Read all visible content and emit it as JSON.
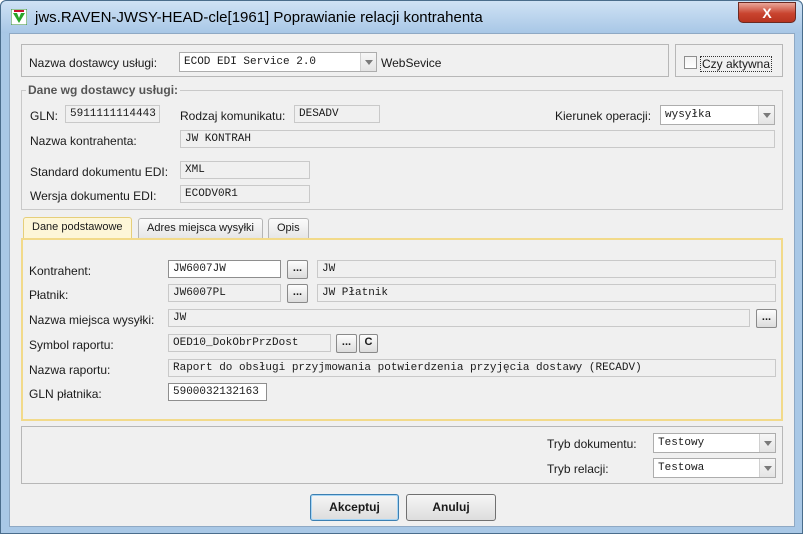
{
  "window": {
    "title": "jws.RAVEN-JWSY-HEAD-cle[1961] Poprawianie relacji kontrahenta",
    "close_label": "X"
  },
  "provider": {
    "label": "Nazwa dostawcy usługi:",
    "value": "ECOD EDI Service 2.0",
    "suffix": "WebSevice",
    "active_label": "Czy aktywna",
    "active_checked": false
  },
  "provider_data": {
    "legend": "Dane wg dostawcy usługi:",
    "gln_label": "GLN:",
    "gln_value": "5911111114443",
    "message_type_label": "Rodzaj komunikatu:",
    "message_type_value": "DESADV",
    "direction_label": "Kierunek operacji:",
    "direction_value": "wysyłka",
    "contractor_name_label": "Nazwa kontrahenta:",
    "contractor_name_value": "JW KONTRAH",
    "edi_standard_label": "Standard dokumentu EDI:",
    "edi_standard_value": "XML",
    "edi_version_label": "Wersja dokumentu EDI:",
    "edi_version_value": "ECODV0R1"
  },
  "tabs": [
    {
      "label": "Dane podstawowe",
      "active": true
    },
    {
      "label": "Adres miejsca wysyłki",
      "active": false
    },
    {
      "label": "Opis",
      "active": false
    }
  ],
  "basic": {
    "contractor_label": "Kontrahent:",
    "contractor_code": "JW6007JW",
    "contractor_name": "JW",
    "payer_label": "Płatnik:",
    "payer_code": "JW6007PL",
    "payer_name": "JW Płatnik",
    "ship_place_label": "Nazwa miejsca wysyłki:",
    "ship_place_value": "JW",
    "report_symbol_label": "Symbol raportu:",
    "report_symbol_value": "OED10_DokObrPrzDost",
    "report_name_label": "Nazwa raportu:",
    "report_name_value": "Raport do obsługi przyjmowania potwierdzenia przyjęcia dostawy (RECADV)",
    "payer_gln_label": "GLN płatnika:",
    "payer_gln_value": "5900032132163",
    "browse_label": "...",
    "clear_label": "C"
  },
  "modes": {
    "doc_mode_label": "Tryb dokumentu:",
    "doc_mode_value": "Testowy",
    "relation_mode_label": "Tryb relacji:",
    "relation_mode_value": "Testowa"
  },
  "buttons": {
    "accept": "Akceptuj",
    "cancel": "Anuluj"
  }
}
